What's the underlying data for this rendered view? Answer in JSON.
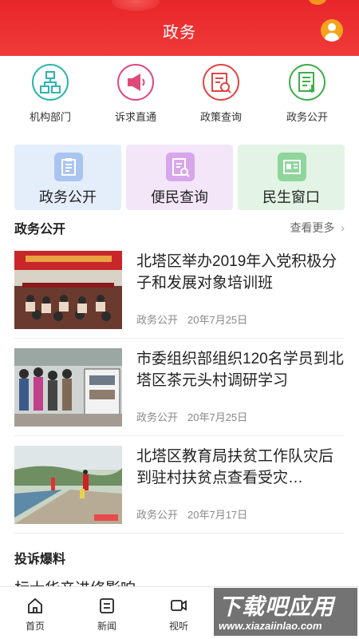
{
  "header": {
    "title": "政务"
  },
  "quick_actions": [
    {
      "label": "机构部门",
      "icon": "org-chart-icon",
      "color": "#2bb5b0"
    },
    {
      "label": "诉求直通",
      "icon": "megaphone-icon",
      "color": "#e04a7a"
    },
    {
      "label": "政策查询",
      "icon": "document-search-icon",
      "color": "#e04545"
    },
    {
      "label": "政务公开",
      "icon": "open-document-icon",
      "color": "#3dae4a"
    }
  ],
  "tiles": [
    {
      "label": "政务公开",
      "icon": "clipboard-icon",
      "bg": "#e4eefb",
      "icon_bg": "#a9c4ef"
    },
    {
      "label": "便民查询",
      "icon": "search-doc-icon",
      "bg": "#f3e6f8",
      "icon_bg": "#d8a6ea"
    },
    {
      "label": "民生窗口",
      "icon": "id-card-icon",
      "bg": "#e3f4e6",
      "icon_bg": "#8fd59c"
    }
  ],
  "section": {
    "title": "政务公开",
    "more": "查看更多"
  },
  "news": [
    {
      "title": "北塔区举办2019年入党积极分子和发展对象培训班",
      "source": "政务公开",
      "date": "20年7月25日"
    },
    {
      "title": "市委组织部组织120名学员到北塔区茶元头村调研学习",
      "source": "政务公开",
      "date": "20年7月25日"
    },
    {
      "title": "北塔区教育局扶贫工作队灾后到驻村扶贫点查看受灾…",
      "source": "政务公开",
      "date": "20年7月17日"
    }
  ],
  "section2": {
    "title": "投诉爆料"
  },
  "peek_text": "标士华产进修影响",
  "tabbar": [
    {
      "label": "首页",
      "icon": "home-icon"
    },
    {
      "label": "新闻",
      "icon": "news-icon"
    },
    {
      "label": "视听",
      "icon": "video-icon"
    }
  ],
  "watermark": {
    "big": "下载吧应用",
    "small": "www.xiazaiinlao.com"
  }
}
